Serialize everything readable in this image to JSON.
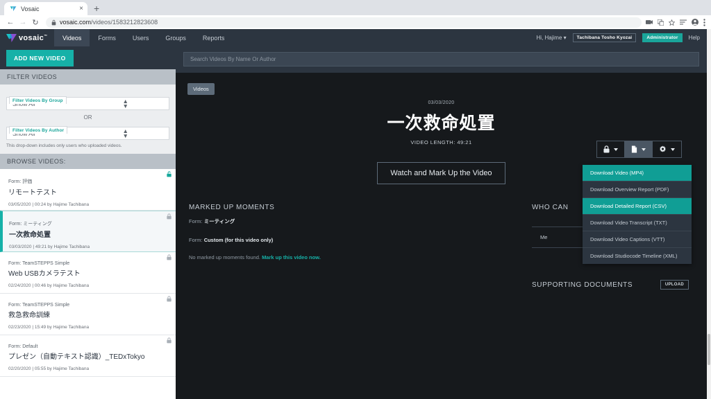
{
  "browser": {
    "tab": {
      "title": "Vosaic",
      "favicon": "vosaic-favicon",
      "close_label": "×",
      "new_tab_label": "+"
    },
    "nav": {
      "back": "←",
      "forward": "→",
      "reload": "↻"
    },
    "omnibox": {
      "lock": "🔒",
      "domain": "vosaic.com",
      "path": "/videos/1583212823608"
    },
    "toolbar_icons": [
      "media-icon",
      "translate-icon",
      "bookmark-star-icon",
      "reading-list-icon",
      "profile-icon",
      "kebab-menu-icon"
    ]
  },
  "navbar": {
    "brand": "vosaic",
    "brand_tm": "™",
    "items": [
      {
        "label": "Videos",
        "active": true
      },
      {
        "label": "Forms",
        "active": false
      },
      {
        "label": "Users",
        "active": false
      },
      {
        "label": "Groups",
        "active": false
      },
      {
        "label": "Reports",
        "active": false
      }
    ],
    "user_greeting": "Hi, Hajime",
    "org_badge": "Tachibana Tosho Kyozai",
    "role_badge": "Administrator",
    "help": "Help"
  },
  "sidebar": {
    "add_video_button": "ADD NEW VIDEO",
    "filter_header": "FILTER VIDEOS",
    "group_filter": {
      "legend": "Filter Videos By Group",
      "value": "Show All"
    },
    "or_text": "OR",
    "author_filter": {
      "legend": "Filter Videos By Author",
      "value": "Show All"
    },
    "hint": "This drop-down includes only users who uploaded videos.",
    "browse_header": "BROWSE VIDEOS:",
    "videos": [
      {
        "form": "Form: 評価",
        "title": "リモートテスト",
        "meta": "03/05/2020 | 00:24 by Hajime Tachibana",
        "selected": false,
        "lock": "unlocked-padlock-icon",
        "lock_color": "#16a89c"
      },
      {
        "form": "Form: ミーティング",
        "title": "一次救命処置",
        "meta": "03/03/2020 | 49:21 by Hajime Tachibana",
        "selected": true,
        "lock": "locked-padlock-icon",
        "lock_color": "#a9b0b7"
      },
      {
        "form": "Form: TeamSTEPPS Simple",
        "title": "Web USBカメラテスト",
        "meta": "02/24/2020 | 00:46 by Hajime Tachibana",
        "selected": false,
        "lock": "locked-padlock-icon",
        "lock_color": "#a9b0b7"
      },
      {
        "form": "Form: TeamSTEPPS Simple",
        "title": "救急救命訓練",
        "meta": "02/23/2020 | 15:49 by Hajime Tachibana",
        "selected": false,
        "lock": "locked-padlock-icon",
        "lock_color": "#a9b0b7"
      },
      {
        "form": "Form: Default",
        "title": "プレゼン（自動テキスト認識）_TEDxTokyo",
        "meta": "02/20/2020 | 05:55 by Hajime Tachibana",
        "selected": false,
        "lock": "locked-padlock-icon",
        "lock_color": "#a9b0b7"
      }
    ]
  },
  "main": {
    "search_placeholder": "Search Videos By Name Or Author",
    "search_value": "",
    "breadcrumb": "Videos",
    "video_date": "03/03/2020",
    "video_title": "一次救命処置",
    "video_length": "VIDEO LENGTH: 49:21",
    "watch_button": "Watch and Mark Up the Video",
    "actions": [
      {
        "icon": "padlock-icon",
        "active": false
      },
      {
        "icon": "file-download-icon",
        "active": true
      },
      {
        "icon": "gear-icon",
        "active": false
      }
    ],
    "download_menu": [
      {
        "label": "Download Video (MP4)",
        "highlighted": true
      },
      {
        "label": "Download Overview Report (PDF)",
        "highlighted": false
      },
      {
        "label": "Download Detailed Report (CSV)",
        "highlighted": true
      },
      {
        "label": "Download Video Transcript (TXT)",
        "highlighted": false
      },
      {
        "label": "Download Video Captions (VTT)",
        "highlighted": false
      },
      {
        "label": "Download Studiocode Timeline (XML)",
        "highlighted": false
      }
    ],
    "marked_up": {
      "heading": "MARKED UP MOMENTS",
      "form_label": "Form:",
      "form_value": "ミーティング",
      "custom_label": "Form:",
      "custom_value": "Custom (for this video only)",
      "empty_text": "No marked up moments found.",
      "empty_link": "Mark up this video now."
    },
    "who_can": {
      "heading": "WHO CAN",
      "rows": [
        "Me"
      ]
    },
    "supporting": {
      "heading": "SUPPORTING DOCUMENTS",
      "upload_button": "UPLOAD"
    }
  },
  "colors": {
    "accent_teal": "#16b1a8",
    "nav_dark": "#2c3540",
    "page_dark": "#16191c",
    "menu_dark": "#2c3540"
  }
}
